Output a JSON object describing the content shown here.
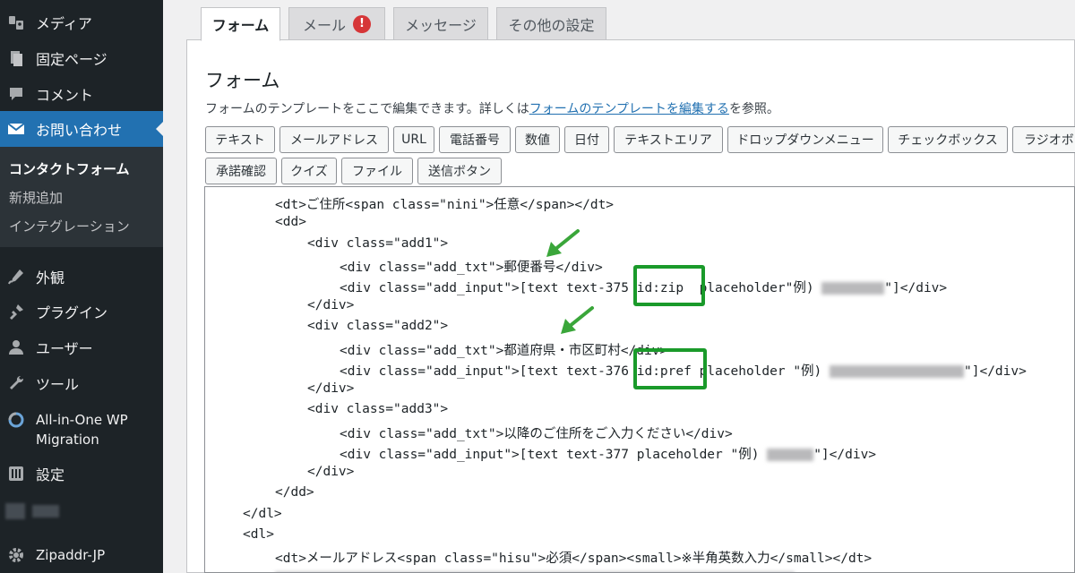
{
  "sidebar": {
    "items": [
      {
        "label": "メディア",
        "icon": "media-icon"
      },
      {
        "label": "固定ページ",
        "icon": "page-icon"
      },
      {
        "label": "コメント",
        "icon": "comment-icon"
      },
      {
        "label": "お問い合わせ",
        "icon": "mail-icon"
      },
      {
        "label": "外観",
        "icon": "appearance-icon"
      },
      {
        "label": "プラグイン",
        "icon": "plugin-icon"
      },
      {
        "label": "ユーザー",
        "icon": "user-icon"
      },
      {
        "label": "ツール",
        "icon": "wrench-icon"
      },
      {
        "label": "All-in-One WP Migration",
        "icon": "migration-icon"
      },
      {
        "label": "設定",
        "icon": "settings-icon"
      },
      {
        "label": "Zipaddr-JP",
        "icon": "gear-icon"
      }
    ],
    "submenu": [
      "コンタクトフォーム",
      "新規追加",
      "インテグレーション"
    ]
  },
  "tabs": [
    {
      "label": "フォーム"
    },
    {
      "label": "メール",
      "badge": "!"
    },
    {
      "label": "メッセージ"
    },
    {
      "label": "その他の設定"
    }
  ],
  "panel": {
    "title": "フォーム",
    "desc_before": "フォームのテンプレートをここで編集できます。詳しくは",
    "desc_link": "フォームのテンプレートを編集する",
    "desc_after": "を参照。"
  },
  "tag_buttons": [
    "テキスト",
    "メールアドレス",
    "URL",
    "電話番号",
    "数値",
    "日付",
    "テキストエリア",
    "ドロップダウンメニュー",
    "チェックボックス",
    "ラジオボタン",
    "承諾確認",
    "クイズ",
    "ファイル",
    "送信ボタン"
  ],
  "code_lines": [
    "<dt>ご住所<span class=\"nini\">任意</span></dt>",
    "<dd>",
    "<div class=\"add1\">",
    "<div class=\"add_txt\">郵便番号</div>",
    "<div class=\"add_input\">[text text-375 id:zip  placeholder\"例) ",
    "\"]</div>",
    "</div>",
    "<div class=\"add2\">",
    "<div class=\"add_txt\">都道府県・市区町村</div>",
    "<div class=\"add_input\">[text text-376 id:pref placeholder \"例) ",
    "\"]</div>",
    "</div>",
    "<div class=\"add3\">",
    "<div class=\"add_txt\">以降のご住所をご入力ください</div>",
    "<div class=\"add_input\">[text text-377 placeholder \"例) ",
    "\"]</div>",
    "</div>",
    "</dd>",
    "</dl>",
    "<dl>",
    "<dt>メールアドレス<span class=\"hisu\">必須</span><small>※半角英数入力</small></dt>"
  ],
  "colors": {
    "sidebar_bg": "#1d2327",
    "active_menu": "#2271b1",
    "highlight": "#1a9a2a",
    "badge": "#d63638"
  }
}
